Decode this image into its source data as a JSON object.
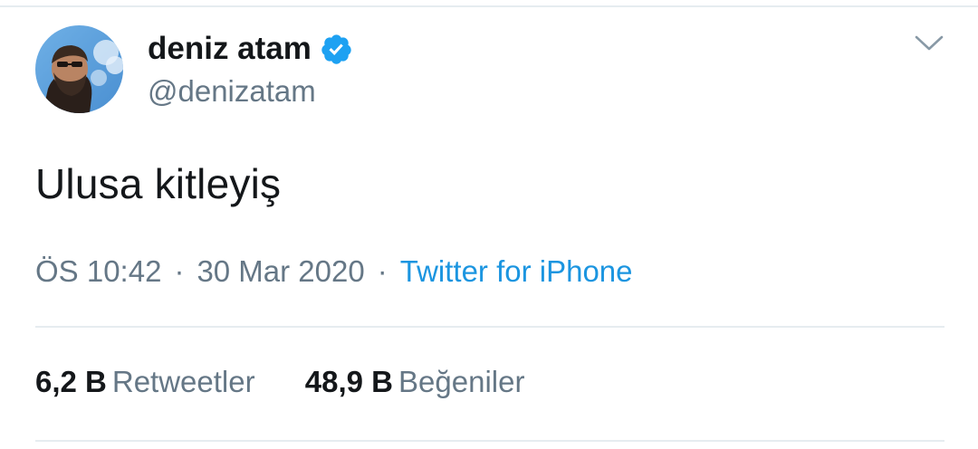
{
  "tweet": {
    "author": {
      "display_name": "deniz atam",
      "handle": "@denizatam",
      "verified": true
    },
    "text": "Ulusa kitleyiş",
    "time": "ÖS 10:42",
    "date": "30 Mar 2020",
    "source": "Twitter for iPhone",
    "separator": "·",
    "stats": {
      "retweets_count": "6,2 B",
      "retweets_label": "Retweetler",
      "likes_count": "48,9 B",
      "likes_label": "Beğeniler"
    }
  },
  "icons": {
    "verified": "verified-badge-icon",
    "menu": "chevron-down-icon"
  },
  "colors": {
    "primary_text": "#14171a",
    "secondary_text": "#657786",
    "link": "#1b95e0",
    "verified": "#1da1f2",
    "divider": "#e6ecf0"
  }
}
